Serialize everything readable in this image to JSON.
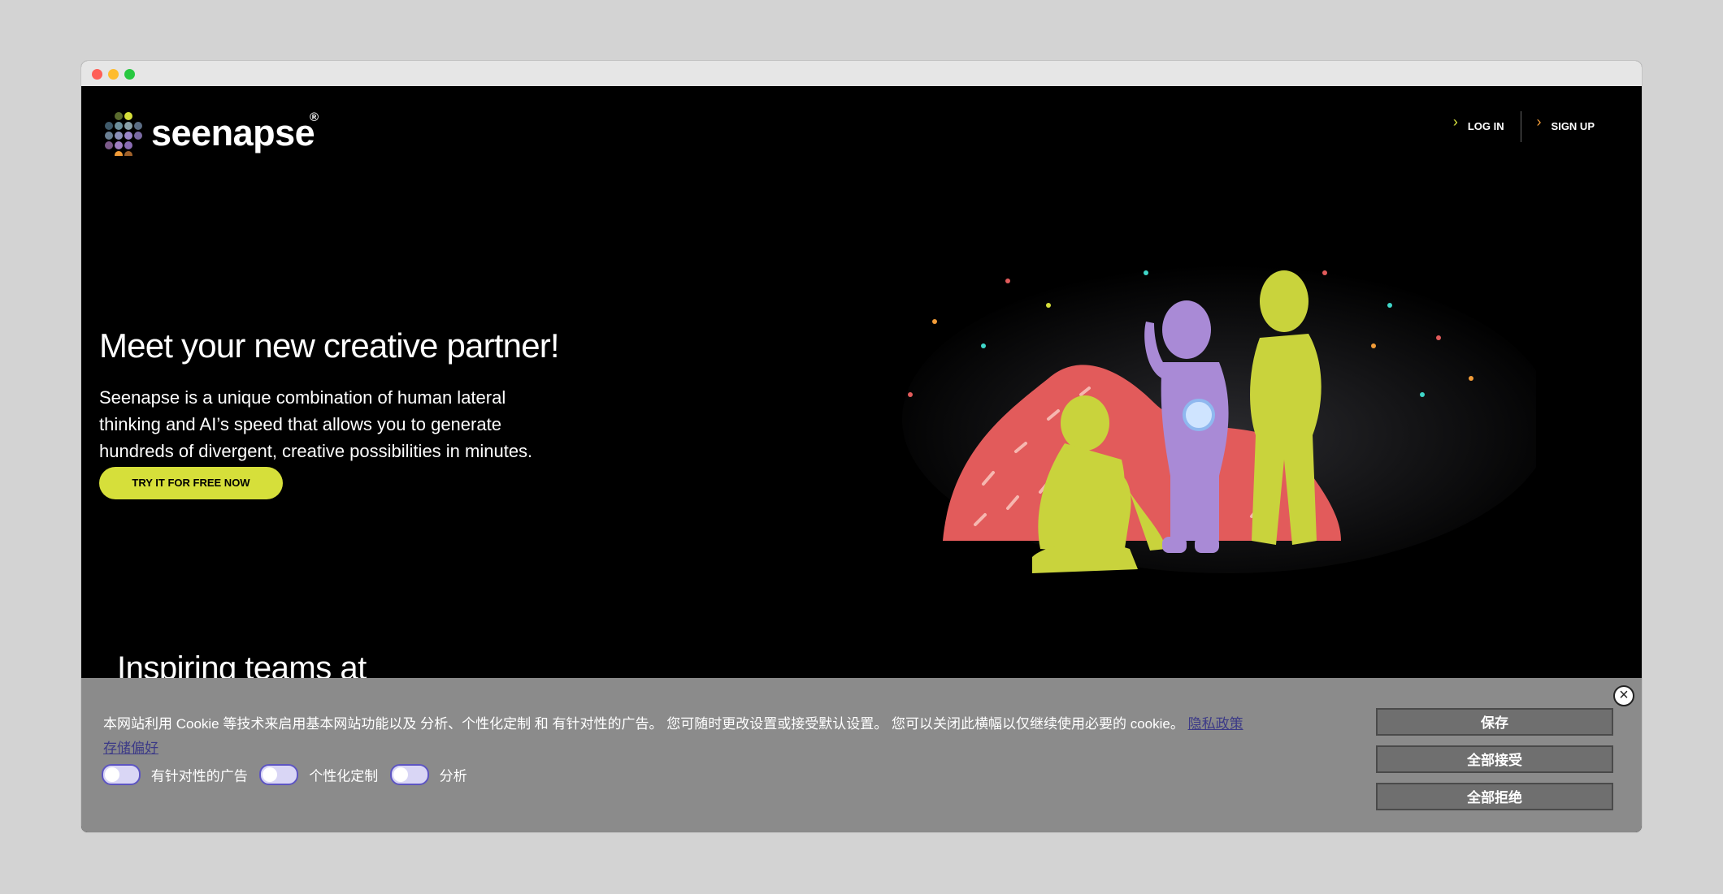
{
  "brand": {
    "name": "seenapse",
    "registered": "®"
  },
  "nav": {
    "login": "LOG IN",
    "signup": "SIGN UP"
  },
  "hero": {
    "title": "Meet your new creative partner!",
    "description": "Seenapse is a unique combination of human lateral thinking and AI’s speed that allows you to generate hundreds of divergent, creative possibilities in minutes.",
    "cta": "TRY IT FOR FREE NOW"
  },
  "teams": {
    "heading": "Inspiring teams at"
  },
  "cookie": {
    "message": "本网站利用 Cookie 等技术来启用基本网站功能以及 分析、个性化定制 和 有针对性的广告。 您可随时更改设置或接受默认设置。 您可以关闭此横幅以仅继续使用必要的 cookie。",
    "privacy_link": "隐私政策",
    "prefs_link": "存储偏好",
    "toggles": [
      {
        "label": "有针对性的广告"
      },
      {
        "label": "个性化定制"
      },
      {
        "label": "分析"
      }
    ],
    "save": "保存",
    "accept_all": "全部接受",
    "reject_all": "全部拒绝"
  },
  "colors": {
    "accent_lime": "#d6df3a",
    "accent_orange": "#f29c38",
    "figure_purple": "#a98ad6",
    "hill_red": "#e25b5b",
    "cookie_bg": "#8b8b8b"
  },
  "icons": {
    "close": "close-circle-icon",
    "chevron": "chevron-right-icon"
  }
}
